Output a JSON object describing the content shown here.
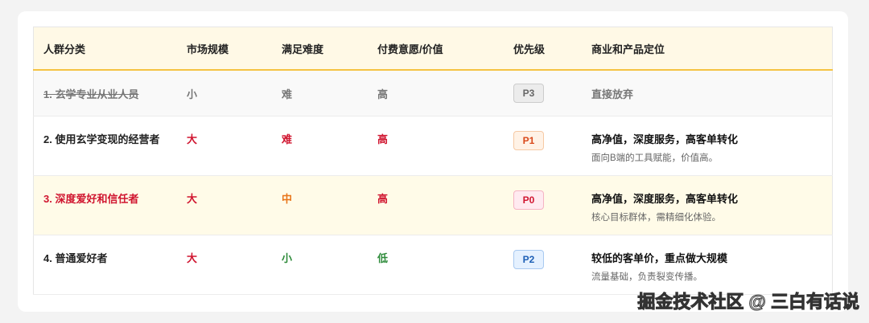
{
  "headers": [
    "人群分类",
    "市场规模",
    "满足难度",
    "付费意愿/价值",
    "优先级",
    "商业和产品定位"
  ],
  "rows": [
    {
      "name": "1. 玄学专业从业人员",
      "market": "小",
      "difficulty": "难",
      "pay": "高",
      "priority": "P3",
      "title": "直接放弃",
      "desc": ""
    },
    {
      "name": "2. 使用玄学变现的经营者",
      "market": "大",
      "difficulty": "难",
      "pay": "高",
      "priority": "P1",
      "title": "高净值，深度服务，高客单转化",
      "desc": "面向B端的工具赋能，价值高。"
    },
    {
      "name": "3. 深度爱好和信任者",
      "market": "大",
      "difficulty": "中",
      "pay": "高",
      "priority": "P0",
      "title": "高净值，深度服务，高客单转化",
      "desc": "核心目标群体，需精细化体验。"
    },
    {
      "name": "4. 普通爱好者",
      "market": "大",
      "difficulty": "小",
      "pay": "低",
      "priority": "P2",
      "title": "较低的客单价，重点做大规模",
      "desc": "流量基础，负责裂变传播。"
    }
  ],
  "watermark": "掘金技术社区 @ 三白有话说"
}
